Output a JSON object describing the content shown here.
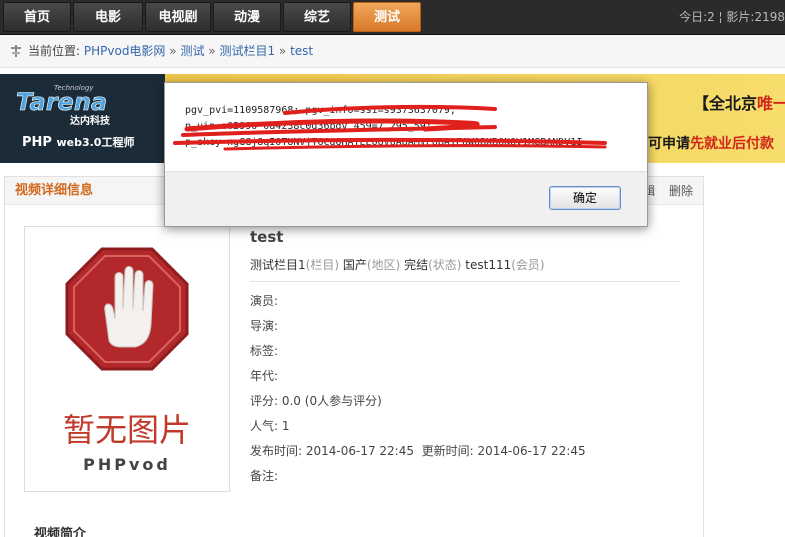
{
  "nav": {
    "tabs": [
      {
        "label": "首页"
      },
      {
        "label": "电影"
      },
      {
        "label": "电视剧"
      },
      {
        "label": "动漫"
      },
      {
        "label": "综艺"
      },
      {
        "label": "测试",
        "active": true
      }
    ],
    "stats": "今日:2 ¦ 影片:2198"
  },
  "breadcrumb": {
    "prefix": "当前位置:",
    "items": [
      "PHPvod电影网",
      "测试",
      "测试栏目1",
      "test"
    ],
    "separator": "»"
  },
  "banner": {
    "logo_top": "Technology",
    "logo_name": "Tarena",
    "logo_cn": "达内科技",
    "sub_main": "PHP",
    "sub_small": "web3.0工程师",
    "right_line1_a": "【全北京",
    "right_line1_b": "唯一",
    "right_line2_a": "可申请",
    "right_line2_b": "先就业后付款"
  },
  "panel": {
    "title": "视频详细信息",
    "edit": "编辑",
    "delete": "删除"
  },
  "poster": {
    "text": "暂无图片",
    "brand": "PHPvod"
  },
  "video": {
    "title": "test",
    "category": "测试栏目1",
    "category_tag": "(栏目)",
    "region": "国产",
    "region_tag": "(地区)",
    "status": "完结",
    "status_tag": "(状态)",
    "member": "test111",
    "member_tag": "(会员)",
    "actors": "演员:",
    "director": "导演:",
    "tags": "标签:",
    "year": "年代:",
    "rating": "评分: 0.0 (0人参与评分)",
    "popularity": "人气: 1",
    "published": "发布时间: 2014-06-17 22:45",
    "updated": "更新时间: 2014-06-17 22:45",
    "remarks": "备注:"
  },
  "intro_heading": "视频简介",
  "dialog": {
    "line1": "pgv_pvi=1109587968; pgv_info=ssi=s9373637079;",
    "line2": "p_uin=o02990_0a4238c0d36pgv_459=7_295_59;",
    "line3": "p_skey=ngGGj8qI0TUNVjT6CgQHATEE0QV0AQAMVPOBA1E0W0BXBQNQV1MGBANDV1I",
    "ok_label": "确定"
  },
  "colors": {
    "accent": "#d9782a",
    "link": "#3366aa",
    "redaction": "#e0201c"
  }
}
